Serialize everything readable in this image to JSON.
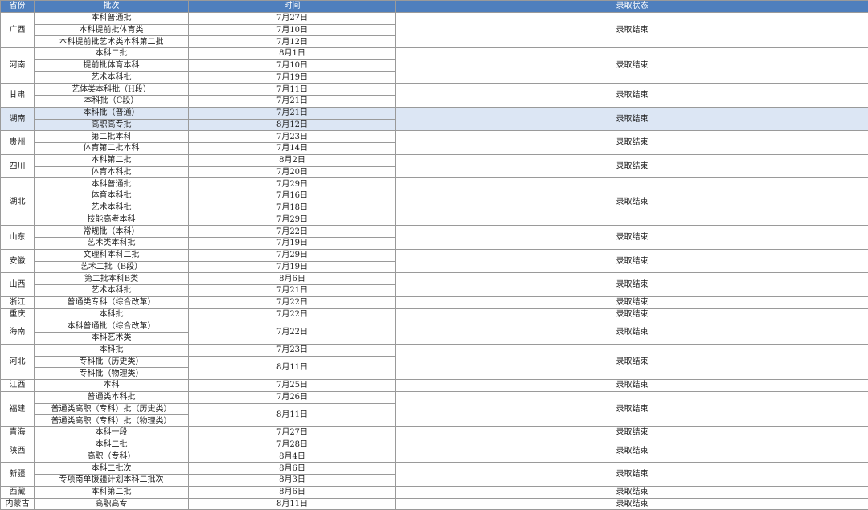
{
  "table": {
    "headers": [
      "省份",
      "批次",
      "时间",
      "录取状态"
    ],
    "rows": [
      {
        "province": "广西",
        "status": "录取结束",
        "batches": [
          {
            "batch": "本科普通批",
            "date": "7月27日"
          },
          {
            "batch": "本科提前批体育类",
            "date": "7月10日"
          },
          {
            "batch": "本科提前批艺术类本科第二批",
            "date": "7月12日"
          }
        ]
      },
      {
        "province": "河南",
        "status": "录取结束",
        "batches": [
          {
            "batch": "本科二批",
            "date": "8月1日"
          },
          {
            "batch": "提前批体育本科",
            "date": "7月10日"
          },
          {
            "batch": "艺术本科批",
            "date": "7月19日"
          }
        ]
      },
      {
        "province": "甘肃",
        "status": "录取结束",
        "batches": [
          {
            "batch": "艺体类本科批（H段）",
            "date": "7月11日"
          },
          {
            "batch": "本科批（C段）",
            "date": "7月21日"
          }
        ]
      },
      {
        "province": "湖南",
        "status": "录取结束",
        "highlight": true,
        "batches": [
          {
            "batch": "本科批（普通）",
            "date": "7月21日"
          },
          {
            "batch": "高职高专批",
            "date": "8月12日"
          }
        ]
      },
      {
        "province": "贵州",
        "status": "录取结束",
        "batches": [
          {
            "batch": "第二批本科",
            "date": "7月23日"
          },
          {
            "batch": "体育第二批本科",
            "date": "7月14日"
          }
        ]
      },
      {
        "province": "四川",
        "status": "录取结束",
        "batches": [
          {
            "batch": "本科第二批",
            "date": "8月2日"
          },
          {
            "batch": "体育本科批",
            "date": "7月20日"
          }
        ]
      },
      {
        "province": "湖北",
        "status": "录取结束",
        "batches": [
          {
            "batch": "本科普通批",
            "date": "7月29日"
          },
          {
            "batch": "体育本科批",
            "date": "7月16日"
          },
          {
            "batch": "艺术本科批",
            "date": "7月18日"
          },
          {
            "batch": "技能高考本科",
            "date": "7月29日"
          }
        ]
      },
      {
        "province": "山东",
        "status": "录取结束",
        "batches": [
          {
            "batch": "常规批（本科）",
            "date": "7月22日"
          },
          {
            "batch": "艺术类本科批",
            "date": "7月19日"
          }
        ]
      },
      {
        "province": "安徽",
        "status": "录取结束",
        "batches": [
          {
            "batch": "文理科本科二批",
            "date": "7月29日"
          },
          {
            "batch": "艺术二批（B段）",
            "date": "7月19日"
          }
        ]
      },
      {
        "province": "山西",
        "status": "录取结束",
        "batches": [
          {
            "batch": "第二批本科B类",
            "date": "8月6日"
          },
          {
            "batch": "艺术本科批",
            "date": "7月21日"
          }
        ]
      },
      {
        "province": "浙江",
        "status": "录取结束",
        "batches": [
          {
            "batch": "普通类专科（综合改革）",
            "date": "7月22日"
          }
        ]
      },
      {
        "province": "重庆",
        "status": "录取结束",
        "batches": [
          {
            "batch": "本科批",
            "date": "7月22日"
          }
        ]
      },
      {
        "province": "海南",
        "status": "录取结束",
        "sharedDate": "7月22日",
        "batches": [
          {
            "batch": "本科普通批（综合改革）"
          },
          {
            "batch": "本科艺术类"
          }
        ]
      },
      {
        "province": "河北",
        "status": "录取结束",
        "batches": [
          {
            "batch": "本科批",
            "date": "7月23日"
          },
          {
            "batch": "专科批（历史类）",
            "date": "8月11日",
            "dateSpan": 2
          },
          {
            "batch": "专科批（物理类）"
          }
        ]
      },
      {
        "province": "江西",
        "status": "录取结束",
        "batches": [
          {
            "batch": "本科",
            "date": "7月25日"
          }
        ]
      },
      {
        "province": "福建",
        "status": "录取结束",
        "batches": [
          {
            "batch": "普通类本科批",
            "date": "7月26日"
          },
          {
            "batch": "普通类高职（专科）批（历史类）",
            "date": "8月11日",
            "dateSpan": 2
          },
          {
            "batch": "普通类高职（专科）批（物理类）"
          }
        ]
      },
      {
        "province": "青海",
        "status": "录取结束",
        "batches": [
          {
            "batch": "本科一段",
            "date": "7月27日"
          }
        ]
      },
      {
        "province": "陕西",
        "status": "录取结束",
        "batches": [
          {
            "batch": "本科二批",
            "date": "7月28日"
          },
          {
            "batch": "高职（专科）",
            "date": "8月4日"
          }
        ]
      },
      {
        "province": "新疆",
        "status": "录取结束",
        "batches": [
          {
            "batch": "本科二批次",
            "date": "8月6日"
          },
          {
            "batch": "专项南单援疆计划本科二批次",
            "date": "8月3日"
          }
        ]
      },
      {
        "province": "西藏",
        "status": "录取结束",
        "batches": [
          {
            "batch": "本科第二批",
            "date": "8月6日"
          }
        ]
      },
      {
        "province": "内蒙古",
        "status": "录取结束",
        "batches": [
          {
            "batch": "高职高专",
            "date": "8月11日"
          }
        ]
      }
    ]
  }
}
